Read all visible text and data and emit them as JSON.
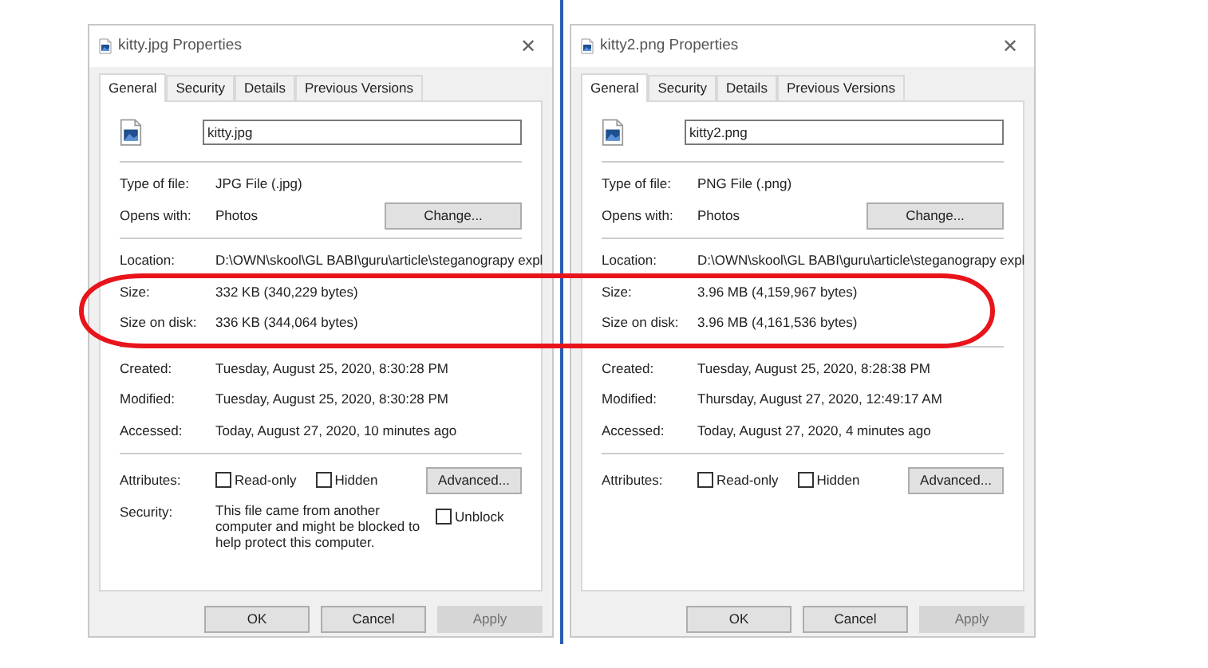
{
  "windows": [
    {
      "title": "kitty.jpg Properties",
      "close": "✕",
      "tabs": [
        {
          "label": "General",
          "selected": true
        },
        {
          "label": "Security",
          "selected": false
        },
        {
          "label": "Details",
          "selected": false
        },
        {
          "label": "Previous Versions",
          "selected": false
        }
      ],
      "file_name": "kitty.jpg",
      "sections": [
        [
          {
            "label": "Type of file:",
            "value": "JPG File (.jpg)"
          },
          {
            "label": "Opens with:",
            "value": "Photos",
            "button": "Change..."
          }
        ],
        [
          {
            "label": "Location:",
            "value": "D:\\OWN\\skool\\GL BABI\\guru\\article\\steganograpy expl"
          },
          {
            "label": "Size:",
            "value": "332 KB (340,229 bytes)"
          },
          {
            "label": "Size on disk:",
            "value": "336 KB (344,064 bytes)"
          }
        ],
        [
          {
            "label": "Created:",
            "value": "Tuesday, August 25, 2020, 8:30:28 PM"
          },
          {
            "label": "Modified:",
            "value": "Tuesday, August 25, 2020, 8:30:28 PM"
          },
          {
            "label": "Accessed:",
            "value": "Today, August 27, 2020, 10 minutes ago"
          }
        ]
      ],
      "attributes": {
        "label": "Attributes:",
        "checkboxes": [
          {
            "label": "Read-only",
            "checked": false
          },
          {
            "label": "Hidden",
            "checked": false
          }
        ],
        "button": "Advanced..."
      },
      "security": {
        "label": "Security:",
        "text": "This file came from another computer and might be blocked to help protect this computer.",
        "unblock": {
          "label": "Unblock",
          "checked": false
        }
      },
      "buttons": [
        {
          "label": "OK",
          "disabled": false
        },
        {
          "label": "Cancel",
          "disabled": false
        },
        {
          "label": "Apply",
          "disabled": true
        }
      ]
    },
    {
      "title": "kitty2.png Properties",
      "close": "✕",
      "tabs": [
        {
          "label": "General",
          "selected": true
        },
        {
          "label": "Security",
          "selected": false
        },
        {
          "label": "Details",
          "selected": false
        },
        {
          "label": "Previous Versions",
          "selected": false
        }
      ],
      "file_name": "kitty2.png",
      "sections": [
        [
          {
            "label": "Type of file:",
            "value": "PNG File (.png)"
          },
          {
            "label": "Opens with:",
            "value": "Photos",
            "button": "Change..."
          }
        ],
        [
          {
            "label": "Location:",
            "value": "D:\\OWN\\skool\\GL BABI\\guru\\article\\steganograpy expl"
          },
          {
            "label": "Size:",
            "value": "3.96 MB (4,159,967 bytes)"
          },
          {
            "label": "Size on disk:",
            "value": "3.96 MB (4,161,536 bytes)"
          }
        ],
        [
          {
            "label": "Created:",
            "value": "Tuesday, August 25, 2020, 8:28:38 PM"
          },
          {
            "label": "Modified:",
            "value": "Thursday, August 27, 2020, 12:49:17 AM"
          },
          {
            "label": "Accessed:",
            "value": "Today, August 27, 2020, 4 minutes ago"
          }
        ]
      ],
      "attributes": {
        "label": "Attributes:",
        "checkboxes": [
          {
            "label": "Read-only",
            "checked": false
          },
          {
            "label": "Hidden",
            "checked": false
          }
        ],
        "button": "Advanced..."
      },
      "buttons": [
        {
          "label": "OK",
          "disabled": false
        },
        {
          "label": "Cancel",
          "disabled": false
        },
        {
          "label": "Apply",
          "disabled": true
        }
      ]
    }
  ]
}
